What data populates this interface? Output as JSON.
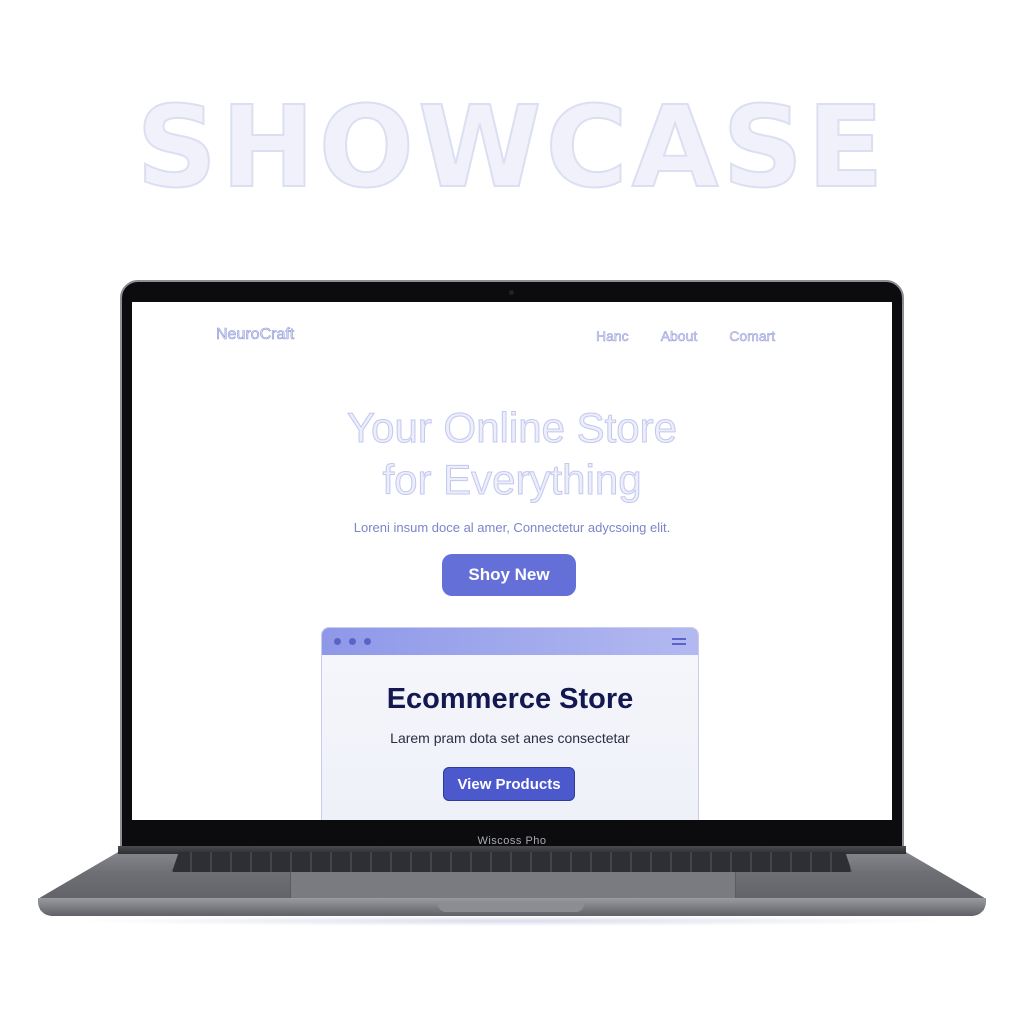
{
  "showcase": {
    "title": "SHOWCASE"
  },
  "laptop": {
    "brand_label": "Wiscoss Pho"
  },
  "site": {
    "logo": "NeuroCraft",
    "nav": [
      {
        "label": "Hanc"
      },
      {
        "label": "About"
      },
      {
        "label": "Comart"
      }
    ],
    "hero": {
      "title_line1": "Your Online Store",
      "title_line2": "for Everything",
      "subtitle": "Loreni insum doce al amer, Connectetur adycsoing elit.",
      "cta_label": "Shoy New"
    },
    "card": {
      "title": "Ecommerce Store",
      "text": "Larem pram dota set anes consectetar",
      "button_label": "View Products"
    }
  },
  "colors": {
    "accent": "#6470d8",
    "accent_dark": "#4c59cc",
    "card_title": "#141850",
    "subtitle": "#7d84c9"
  },
  "icons": {
    "window_dots": "three-dots-icon",
    "card_menu": "hamburger-menu-icon"
  }
}
